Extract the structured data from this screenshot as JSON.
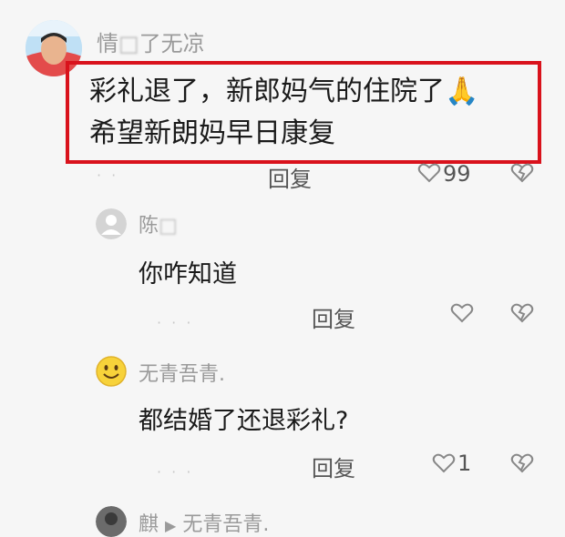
{
  "comment": {
    "username": "情",
    "username_obscured": "了无凉",
    "text_line1": "彩礼退了，新郎妈气的住院了",
    "emoji": "🙏",
    "text_line2": "希望新朗妈早日康复",
    "reply_label": "回复",
    "like_count": "99"
  },
  "replies": [
    {
      "username": "陈",
      "text": "你咋知道",
      "reply_label": "回复",
      "like_count": ""
    },
    {
      "username": "无青吾青.",
      "text": "都结婚了还退彩礼?",
      "reply_label": "回复",
      "like_count": "1"
    }
  ],
  "next_reply": {
    "username": "麒",
    "target": "无青吾青."
  },
  "colors": {
    "highlight_border": "#d9121c",
    "username": "#9a9a9a",
    "background": "#f6f6f6"
  }
}
